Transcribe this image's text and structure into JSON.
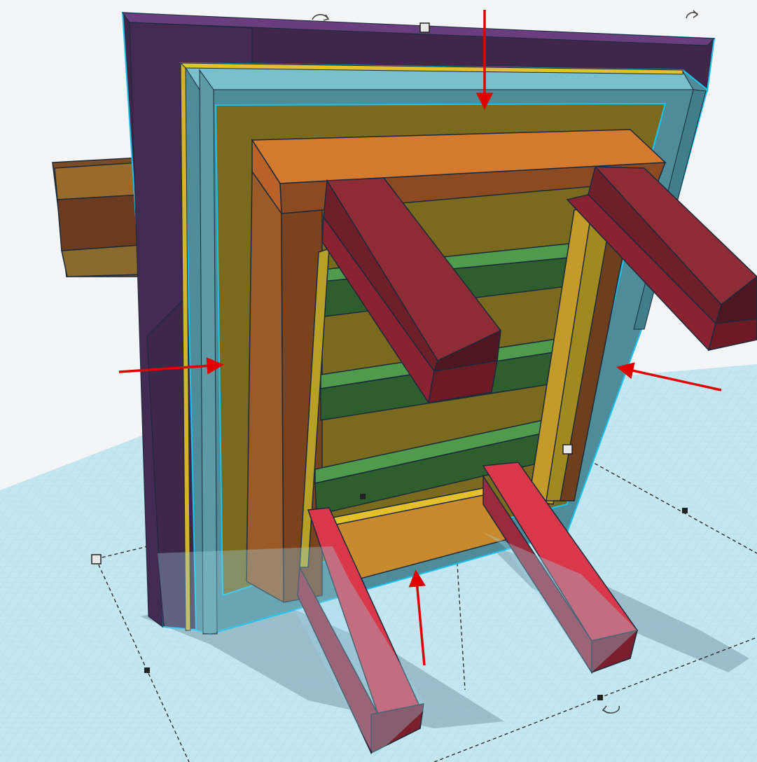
{
  "app": {
    "view": "3d-workplane",
    "selection": "grouped-shapes"
  },
  "icons": {
    "rotate_handle_top": "rotate-arrow-icon",
    "rotate_handle_right": "rotate-arrow-icon",
    "rotate_handle_bottom": "rotate-arrow-icon",
    "resize_handle": "square-handle-icon"
  },
  "colors": {
    "workplane": "#bfe3ef",
    "grid_line": "#8fcbe0",
    "selection_outline": "#18c3f0",
    "purple": "#4a2b55",
    "teal": "#5aa8b4",
    "olive": "#7a6a1e",
    "orange": "#d47a2e",
    "brown": "#8b4a22",
    "green": "#3d7a3c",
    "red": "#a0283a",
    "annotation_arrow": "#e00000"
  },
  "annotations": {
    "arrow_count": 4,
    "arrow_color": "red"
  }
}
